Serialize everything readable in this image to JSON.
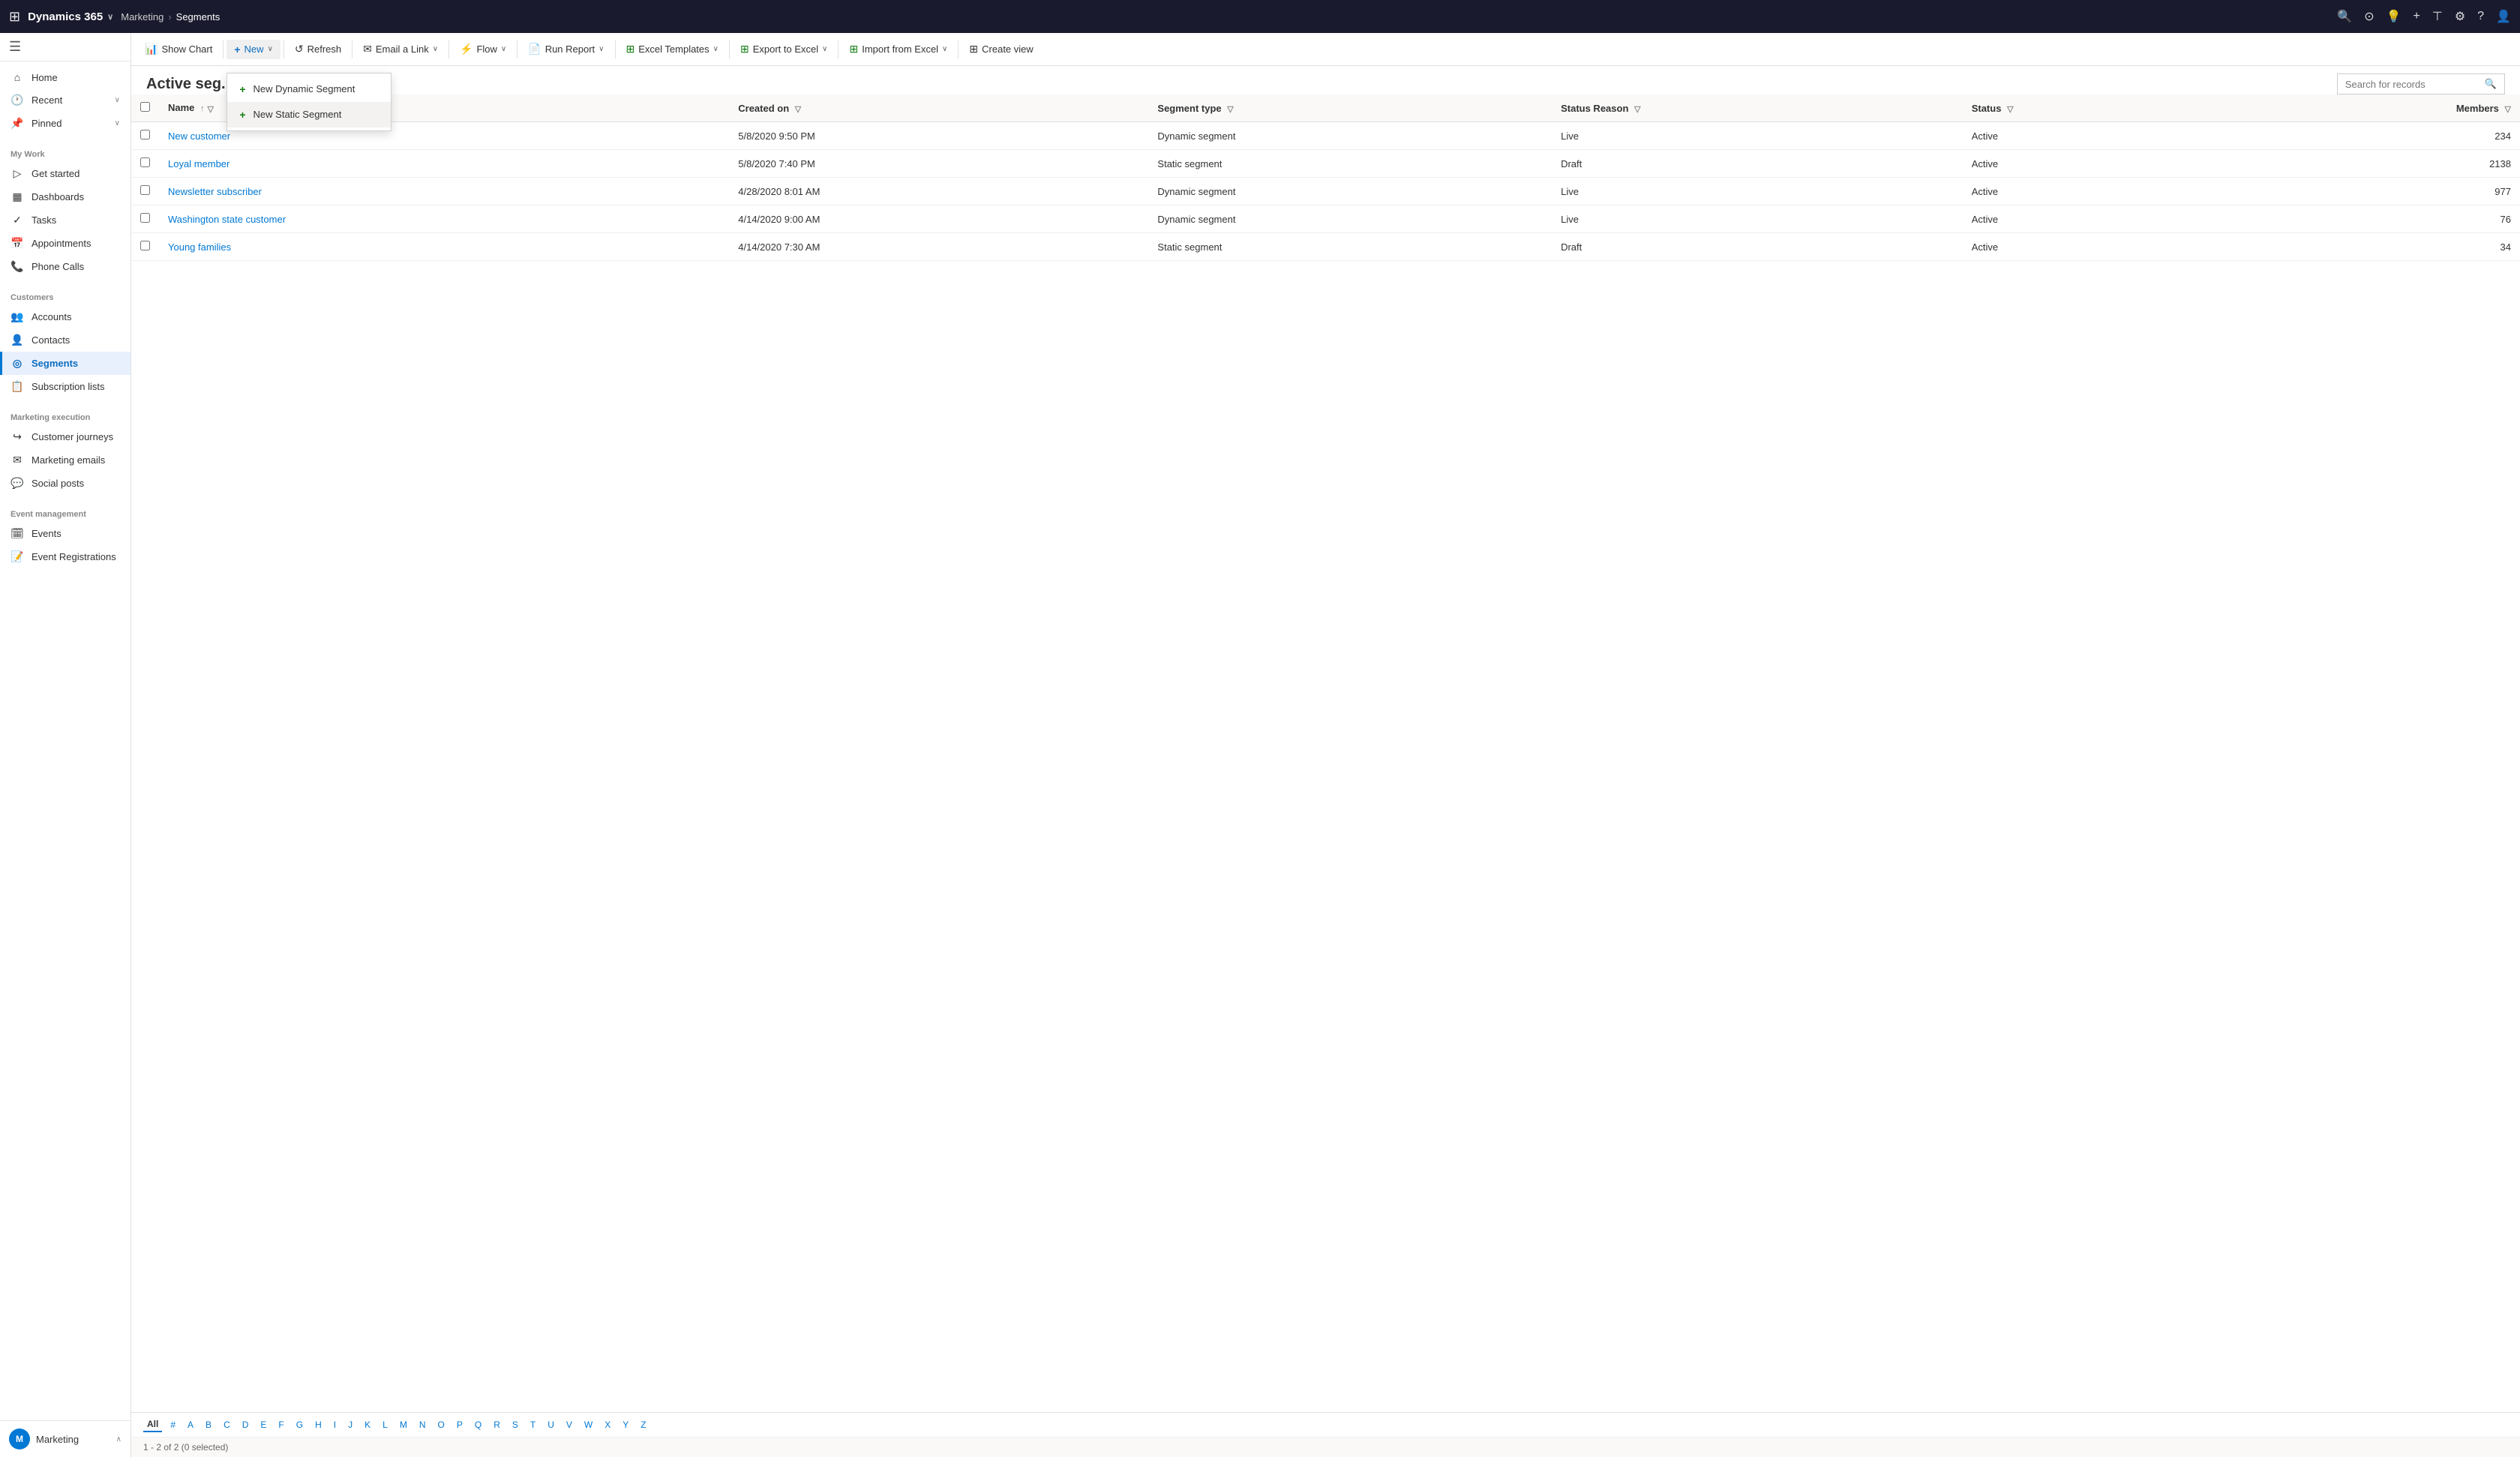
{
  "topNav": {
    "appName": "Dynamics 365",
    "chevron": "∨",
    "module": "Marketing",
    "breadcrumb": [
      "Marketing",
      "Segments"
    ],
    "actions": [
      "🔍",
      "⊙",
      "💡",
      "+",
      "⊤",
      "⚙",
      "?",
      "👤"
    ]
  },
  "sidebar": {
    "hamburger": "☰",
    "topItems": [
      {
        "label": "Home",
        "icon": "⌂",
        "id": "home"
      },
      {
        "label": "Recent",
        "icon": "🕐",
        "id": "recent",
        "chevron": "∨"
      },
      {
        "label": "Pinned",
        "icon": "📌",
        "id": "pinned",
        "chevron": "∨"
      }
    ],
    "sections": [
      {
        "header": "My Work",
        "items": [
          {
            "label": "Get started",
            "icon": "▷",
            "id": "get-started"
          },
          {
            "label": "Dashboards",
            "icon": "▦",
            "id": "dashboards"
          },
          {
            "label": "Tasks",
            "icon": "✓",
            "id": "tasks"
          },
          {
            "label": "Appointments",
            "icon": "📅",
            "id": "appointments"
          },
          {
            "label": "Phone Calls",
            "icon": "📞",
            "id": "phone-calls"
          }
        ]
      },
      {
        "header": "Customers",
        "items": [
          {
            "label": "Accounts",
            "icon": "👥",
            "id": "accounts"
          },
          {
            "label": "Contacts",
            "icon": "👤",
            "id": "contacts"
          },
          {
            "label": "Segments",
            "icon": "◎",
            "id": "segments",
            "active": true
          },
          {
            "label": "Subscription lists",
            "icon": "📋",
            "id": "subscription-lists"
          }
        ]
      },
      {
        "header": "Marketing execution",
        "items": [
          {
            "label": "Customer journeys",
            "icon": "↪",
            "id": "customer-journeys"
          },
          {
            "label": "Marketing emails",
            "icon": "✉",
            "id": "marketing-emails"
          },
          {
            "label": "Social posts",
            "icon": "💬",
            "id": "social-posts"
          }
        ]
      },
      {
        "header": "Event management",
        "items": [
          {
            "label": "Events",
            "icon": "🗓",
            "id": "events"
          },
          {
            "label": "Event Registrations",
            "icon": "📝",
            "id": "event-registrations"
          }
        ]
      }
    ],
    "bottomUser": {
      "label": "Marketing",
      "initials": "M"
    }
  },
  "commandBar": {
    "buttons": [
      {
        "id": "show-chart",
        "icon": "📊",
        "label": "Show Chart",
        "caret": false
      },
      {
        "id": "new",
        "icon": "+",
        "label": "New",
        "caret": true,
        "active": true
      },
      {
        "id": "refresh",
        "icon": "↺",
        "label": "Refresh",
        "caret": false
      },
      {
        "id": "email-link",
        "icon": "✉",
        "label": "Email a Link",
        "caret": true
      },
      {
        "id": "flow",
        "icon": "⚡",
        "label": "Flow",
        "caret": true
      },
      {
        "id": "run-report",
        "icon": "📄",
        "label": "Run Report",
        "caret": true
      },
      {
        "id": "excel-templates",
        "icon": "🟢",
        "label": "Excel Templates",
        "caret": true
      },
      {
        "id": "export-excel",
        "icon": "🟢",
        "label": "Export to Excel",
        "caret": true
      },
      {
        "id": "import-excel",
        "icon": "🟢",
        "label": "Import from Excel",
        "caret": true
      },
      {
        "id": "create-view",
        "icon": "⊞",
        "label": "Create view",
        "caret": false
      }
    ],
    "dropdown": {
      "visible": true,
      "items": [
        {
          "id": "new-dynamic",
          "icon": "+",
          "label": "New Dynamic Segment"
        },
        {
          "id": "new-static",
          "icon": "+",
          "label": "New Static Segment"
        }
      ]
    }
  },
  "page": {
    "title": "Active seg...",
    "searchPlaceholder": "Search for records"
  },
  "table": {
    "columns": [
      {
        "id": "check",
        "label": ""
      },
      {
        "id": "name",
        "label": "Name",
        "sortable": true,
        "filterable": true
      },
      {
        "id": "created-on",
        "label": "Created on",
        "filterable": true
      },
      {
        "id": "segment-type",
        "label": "Segment type",
        "filterable": true
      },
      {
        "id": "status-reason",
        "label": "Status Reason",
        "filterable": true
      },
      {
        "id": "status",
        "label": "Status",
        "filterable": true
      },
      {
        "id": "members",
        "label": "Members",
        "filterable": true
      }
    ],
    "rows": [
      {
        "name": "New customer",
        "createdOn": "5/8/2020 9:50 PM",
        "segmentType": "Dynamic segment",
        "statusReason": "Live",
        "status": "Active",
        "members": 234
      },
      {
        "name": "Loyal member",
        "createdOn": "5/8/2020 7:40 PM",
        "segmentType": "Static segment",
        "statusReason": "Draft",
        "status": "Active",
        "members": 2138
      },
      {
        "name": "Newsletter subscriber",
        "createdOn": "4/28/2020 8:01 AM",
        "segmentType": "Dynamic segment",
        "statusReason": "Live",
        "status": "Active",
        "members": 977
      },
      {
        "name": "Washington state customer",
        "createdOn": "4/14/2020 9:00 AM",
        "segmentType": "Dynamic segment",
        "statusReason": "Live",
        "status": "Active",
        "members": 76
      },
      {
        "name": "Young families",
        "createdOn": "4/14/2020 7:30 AM",
        "segmentType": "Static segment",
        "statusReason": "Draft",
        "status": "Active",
        "members": 34
      }
    ]
  },
  "alphaBar": {
    "items": [
      "All",
      "#",
      "A",
      "B",
      "C",
      "D",
      "E",
      "F",
      "G",
      "H",
      "I",
      "J",
      "K",
      "L",
      "M",
      "N",
      "O",
      "P",
      "Q",
      "R",
      "S",
      "T",
      "U",
      "V",
      "W",
      "X",
      "Y",
      "Z"
    ],
    "active": "All"
  },
  "footer": {
    "text": "1 - 2 of 2 (0 selected)"
  }
}
